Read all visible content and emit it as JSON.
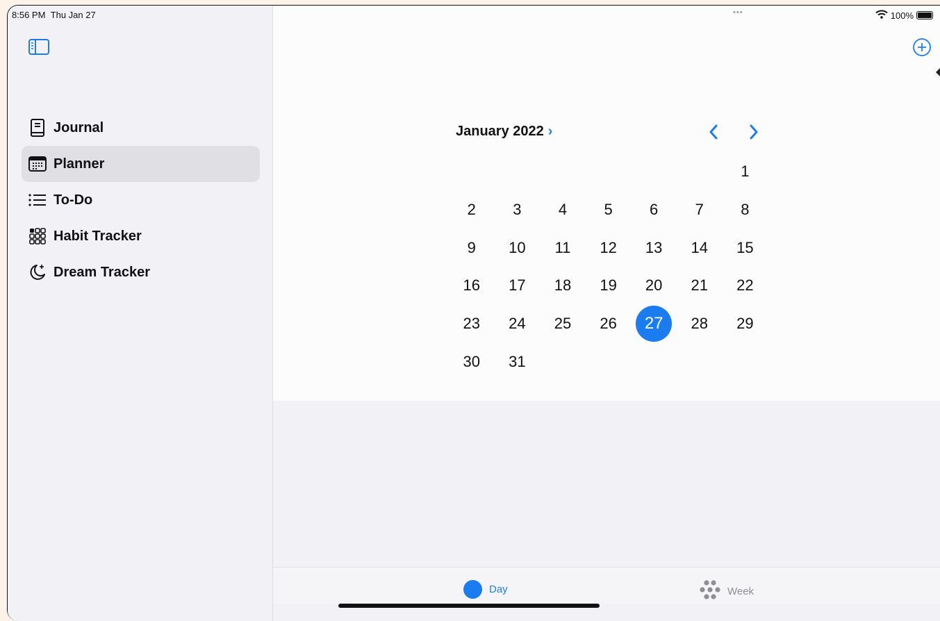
{
  "status_bar": {
    "time": "8:56 PM",
    "date": "Thu Jan 27",
    "multitasking_dots": "•••",
    "battery": "100%"
  },
  "sidebar": {
    "items": [
      {
        "label": "Journal",
        "icon": "book-icon",
        "selected": false
      },
      {
        "label": "Planner",
        "icon": "calendar-icon",
        "selected": true
      },
      {
        "label": "To-Do",
        "icon": "list-icon",
        "selected": false
      },
      {
        "label": "Habit Tracker",
        "icon": "grid-icon",
        "selected": false
      },
      {
        "label": "Dream Tracker",
        "icon": "moon-icon",
        "selected": false
      }
    ]
  },
  "calendar": {
    "month_label": "January 2022",
    "month_chevron": "›",
    "leading_blanks": 6,
    "days": [
      "1",
      "2",
      "3",
      "4",
      "5",
      "6",
      "7",
      "8",
      "9",
      "10",
      "11",
      "12",
      "13",
      "14",
      "15",
      "16",
      "17",
      "18",
      "19",
      "20",
      "21",
      "22",
      "23",
      "24",
      "25",
      "26",
      "27",
      "28",
      "29",
      "30",
      "31"
    ],
    "selected_day": "27"
  },
  "tabs": {
    "day": "Day",
    "week": "Week"
  },
  "colors": {
    "accent": "#1b7cf0",
    "sidebar_bg": "#f2f1f6",
    "selected_bg": "#e0dfe4"
  }
}
